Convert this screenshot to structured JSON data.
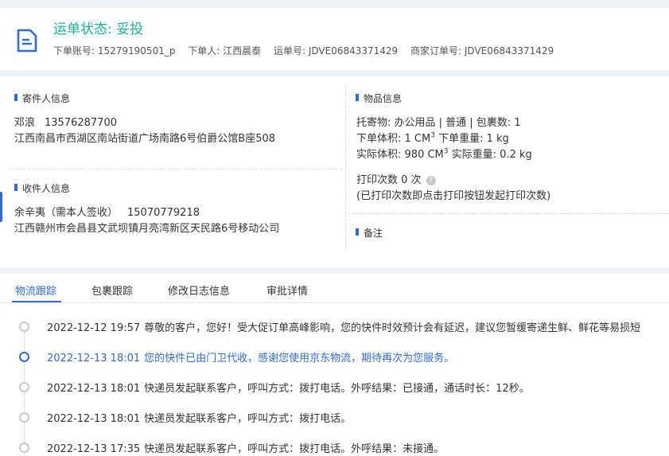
{
  "header": {
    "status_title": "运单状态: 妥投",
    "meta": [
      "下单账号: 15279190501_p",
      "下单人: 江西晨泰",
      "运单号: JDVE06843371429",
      "商家订单号: JDVE06843371429"
    ]
  },
  "sender": {
    "section_title": "寄件人信息",
    "name": "邓浪",
    "phone": "13576287700",
    "address": "江西南昌市西湖区南站街道广场南路6号伯爵公馆B座508"
  },
  "receiver": {
    "section_title": "收件人信息",
    "name": "余辛夷（需本人签收）",
    "phone": "15070779218",
    "address": "江西赣州市会昌县文武坝镇月亮湾新区天民路6号移动公司"
  },
  "goods": {
    "section_title": "物品信息",
    "line1": "托寄物: 办公用品 | 普通 | 包裹数: 1",
    "order_volume_label": "下单体积:",
    "order_volume_value": "1 CM",
    "order_weight": "下单重量: 1 kg",
    "actual_volume_label": "实际体积:",
    "actual_volume_value": "980 CM",
    "actual_weight": "实际重量: 0.2 kg",
    "volume_exp": "3",
    "print_count": "打印次数 0 次",
    "print_note": "(已打印次数即点击打印按钮发起打印次数)"
  },
  "remark": {
    "section_title": "备注"
  },
  "tabs": [
    "物流跟踪",
    "包裹跟踪",
    "修改日志信息",
    "审批详情"
  ],
  "events": [
    {
      "time": "2022-12-12 19:57",
      "text": "尊敬的客户，您好！受大促订单高峰影响，您的快件时效预计会有延迟，建议您暂缓寄递生鲜、鲜花等易损短"
    },
    {
      "time": "2022-12-13 18:01",
      "text": "您的快件已由门卫代收，感谢您使用京东物流，期待再次为您服务。"
    },
    {
      "time": "2022-12-13 18:01",
      "text": "快递员发起联系客户，呼叫方式：拨打电话。外呼结果：已接通，通话时长：12秒。"
    },
    {
      "time": "2022-12-13 18:01",
      "text": "快递员发起联系客户，呼叫方式：拨打电话。"
    },
    {
      "time": "2022-12-13 17:35",
      "text": "快递员发起联系客户，呼叫方式：拨打电话。外呼结果：未接通。"
    }
  ],
  "colors": {
    "accent": "#2f6bd9",
    "status": "#1ab394"
  }
}
